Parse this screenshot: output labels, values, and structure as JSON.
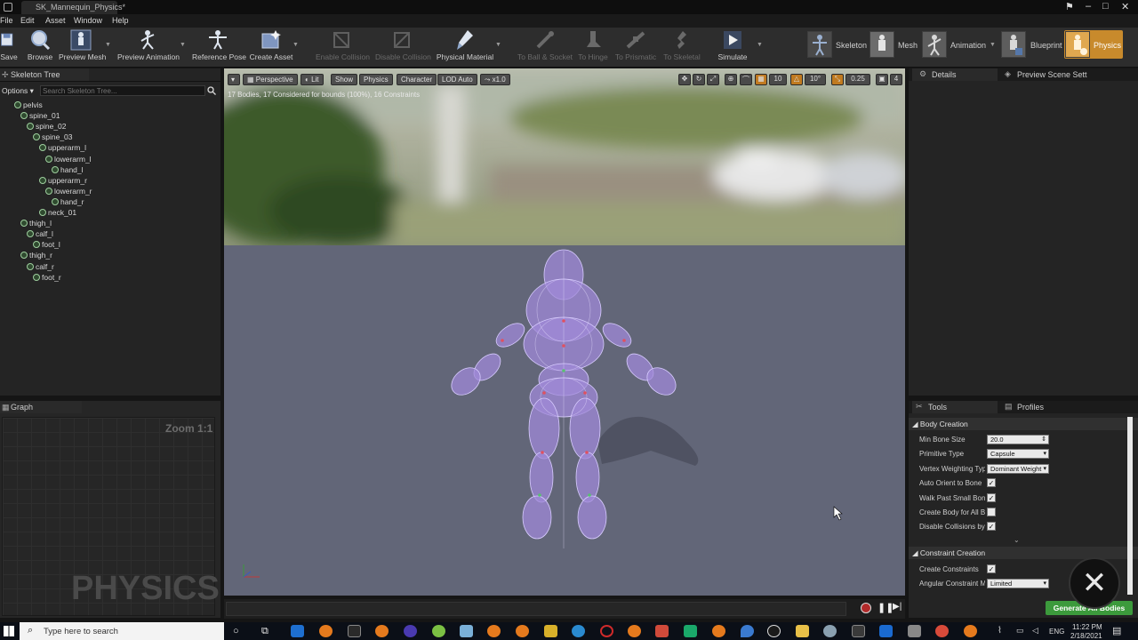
{
  "window": {
    "tab_title": "SK_Mannequin_Physics*"
  },
  "menu": [
    "File",
    "Edit",
    "Asset",
    "Window",
    "Help"
  ],
  "toolbar": {
    "buttons": [
      {
        "label": "Save",
        "icon": "save-icon",
        "enabled": true
      },
      {
        "label": "Browse",
        "icon": "browse-icon",
        "enabled": true
      },
      {
        "label": "Preview Mesh",
        "icon": "preview-mesh-icon",
        "enabled": true
      },
      {
        "label": "Preview Animation",
        "icon": "preview-animation-icon",
        "enabled": true
      },
      {
        "label": "Reference Pose",
        "icon": "reference-pose-icon",
        "enabled": true
      },
      {
        "label": "Create Asset",
        "icon": "create-asset-icon",
        "enabled": true
      },
      {
        "label": "Enable Collision",
        "icon": "enable-collision-icon",
        "enabled": false
      },
      {
        "label": "Disable Collision",
        "icon": "disable-collision-icon",
        "enabled": false
      },
      {
        "label": "Physical Material",
        "icon": "physical-material-icon",
        "enabled": true
      },
      {
        "label": "To Ball & Socket",
        "icon": "ball-socket-icon",
        "enabled": false
      },
      {
        "label": "To Hinge",
        "icon": "hinge-icon",
        "enabled": false
      },
      {
        "label": "To Prismatic",
        "icon": "prismatic-icon",
        "enabled": false
      },
      {
        "label": "To Skeletal",
        "icon": "skeletal-icon",
        "enabled": false
      },
      {
        "label": "Simulate",
        "icon": "simulate-icon",
        "enabled": true
      }
    ],
    "modes": [
      "Skeleton",
      "Mesh",
      "Animation",
      "Blueprint",
      "Physics"
    ],
    "active_mode": "Physics"
  },
  "skeleton_tree": {
    "title": "Skeleton Tree",
    "options_label": "Options",
    "search_placeholder": "Search Skeleton Tree...",
    "bones": [
      {
        "name": "pelvis",
        "depth": 0
      },
      {
        "name": "spine_01",
        "depth": 1
      },
      {
        "name": "spine_02",
        "depth": 2
      },
      {
        "name": "spine_03",
        "depth": 3
      },
      {
        "name": "upperarm_l",
        "depth": 4
      },
      {
        "name": "lowerarm_l",
        "depth": 5
      },
      {
        "name": "hand_l",
        "depth": 6
      },
      {
        "name": "upperarm_r",
        "depth": 4
      },
      {
        "name": "lowerarm_r",
        "depth": 5
      },
      {
        "name": "hand_r",
        "depth": 6
      },
      {
        "name": "neck_01",
        "depth": 4
      },
      {
        "name": "thigh_l",
        "depth": 1
      },
      {
        "name": "calf_l",
        "depth": 2
      },
      {
        "name": "foot_l",
        "depth": 3
      },
      {
        "name": "thigh_r",
        "depth": 1
      },
      {
        "name": "calf_r",
        "depth": 2
      },
      {
        "name": "foot_r",
        "depth": 3
      }
    ]
  },
  "graph": {
    "title": "Graph",
    "zoom": "Zoom 1:1",
    "watermark": "PHYSICS"
  },
  "viewport": {
    "buttons": [
      "Perspective",
      "Lit",
      "Show",
      "Physics",
      "Character",
      "LOD Auto",
      "x1.0"
    ],
    "status": "17 Bodies, 17 Considered for bounds (100%), 16 Constraints",
    "grid_snap": "10",
    "rot_snap": "10°",
    "scale_snap": "0.25",
    "cam_speed": "4"
  },
  "details": {
    "tab_details": "Details",
    "tab_preview": "Preview Scene Sett"
  },
  "tools": {
    "tab_tools": "Tools",
    "tab_profiles": "Profiles",
    "body_section": "Body Creation",
    "rows": [
      {
        "label": "Min Bone Size",
        "value": "20.0",
        "kind": "spin"
      },
      {
        "label": "Primitive Type",
        "value": "Capsule",
        "kind": "combo"
      },
      {
        "label": "Vertex Weighting Type",
        "value": "Dominant Weight",
        "kind": "combo"
      },
      {
        "label": "Auto Orient to Bone",
        "value": "✓",
        "kind": "check"
      },
      {
        "label": "Walk Past Small Bones",
        "value": "✓",
        "kind": "check"
      },
      {
        "label": "Create Body for All Bones",
        "value": "",
        "kind": "check"
      },
      {
        "label": "Disable Collisions by Default",
        "value": "✓",
        "kind": "check"
      }
    ],
    "constraint_section": "Constraint Creation",
    "constraint_rows": [
      {
        "label": "Create Constraints",
        "value": "✓",
        "kind": "check"
      },
      {
        "label": "Angular Constraint Mode",
        "value": "Limited",
        "kind": "combo"
      }
    ],
    "generate_label": "Generate All Bodies"
  },
  "taskbar": {
    "search_placeholder": "Type here to search",
    "time": "11:22 PM",
    "date": "2/18/2021",
    "lang": "ENG"
  }
}
